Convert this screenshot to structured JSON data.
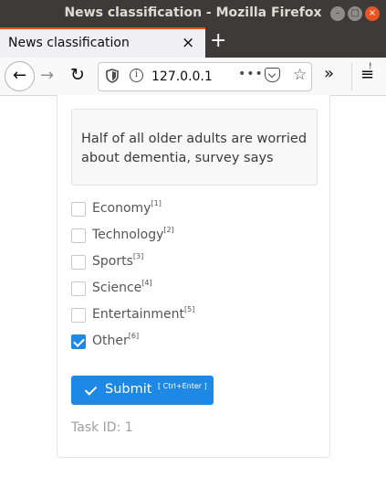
{
  "window": {
    "title": "News classification - Mozilla Firefox",
    "controls": {
      "minimize": "–",
      "maximize": "□",
      "close": "×"
    }
  },
  "tab": {
    "label": "News classification",
    "close": "×",
    "new_tab": "+"
  },
  "navbar": {
    "back": "←",
    "forward": "→",
    "reload": "↻",
    "url": "127.0.0.1",
    "more": "•••",
    "star": "☆",
    "overflow": "»",
    "menu": "≡",
    "menu_warning": "!"
  },
  "task": {
    "text": "Half of all older adults are worried about dementia, survey says",
    "options": [
      {
        "label": "Economy",
        "key": "[1]",
        "checked": false
      },
      {
        "label": "Technology",
        "key": "[2]",
        "checked": false
      },
      {
        "label": "Sports",
        "key": "[3]",
        "checked": false
      },
      {
        "label": "Science",
        "key": "[4]",
        "checked": false
      },
      {
        "label": "Entertainment",
        "key": "[5]",
        "checked": false
      },
      {
        "label": "Other",
        "key": "[6]",
        "checked": true
      }
    ],
    "submit_label": "Submit",
    "submit_hint": "[ Ctrl+Enter ]",
    "task_id": "Task ID: 1"
  },
  "colors": {
    "accent": "#1e88e5",
    "firefox_tab_accent": "#e95420",
    "titlebar": "#3c3b37"
  }
}
